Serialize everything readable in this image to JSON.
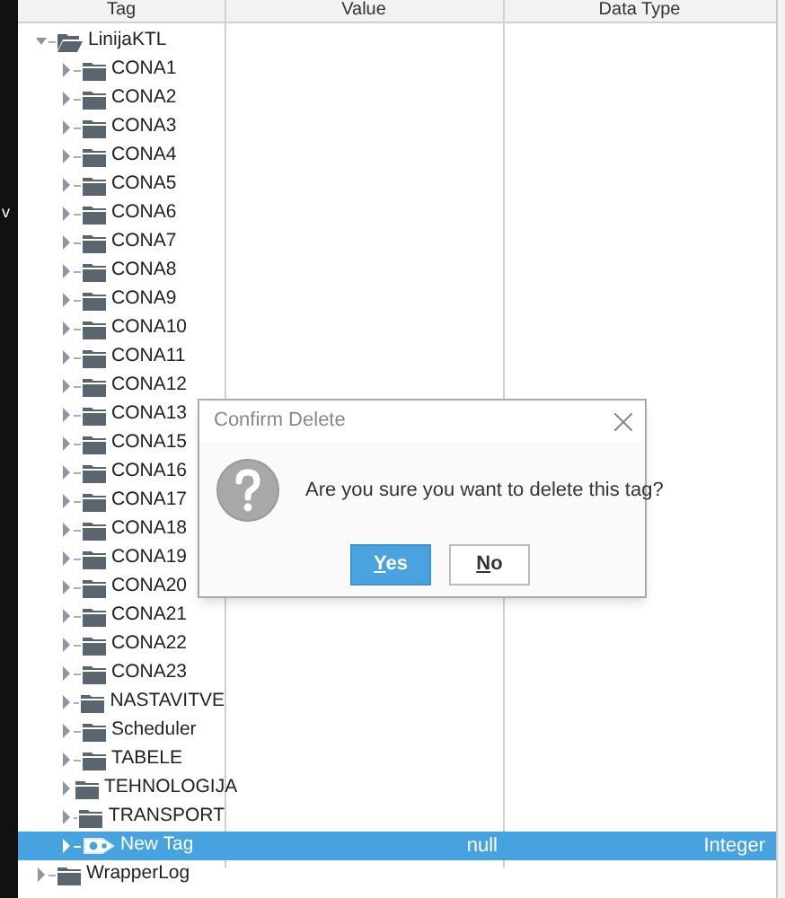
{
  "left_strip": {
    "text": "v"
  },
  "columns": [
    "Tag",
    "Value",
    "Data Type"
  ],
  "tree": [
    {
      "label": "LinijaKTL",
      "kind": "folder",
      "expanded": true,
      "selected": false,
      "children": [
        {
          "label": "CONA1",
          "kind": "folder",
          "expanded": false,
          "selected": false
        },
        {
          "label": "CONA2",
          "kind": "folder",
          "expanded": false,
          "selected": false
        },
        {
          "label": "CONA3",
          "kind": "folder",
          "expanded": false,
          "selected": false
        },
        {
          "label": "CONA4",
          "kind": "folder",
          "expanded": false,
          "selected": false
        },
        {
          "label": "CONA5",
          "kind": "folder",
          "expanded": false,
          "selected": false
        },
        {
          "label": "CONA6",
          "kind": "folder",
          "expanded": false,
          "selected": false
        },
        {
          "label": "CONA7",
          "kind": "folder",
          "expanded": false,
          "selected": false
        },
        {
          "label": "CONA8",
          "kind": "folder",
          "expanded": false,
          "selected": false
        },
        {
          "label": "CONA9",
          "kind": "folder",
          "expanded": false,
          "selected": false
        },
        {
          "label": "CONA10",
          "kind": "folder",
          "expanded": false,
          "selected": false
        },
        {
          "label": "CONA11",
          "kind": "folder",
          "expanded": false,
          "selected": false
        },
        {
          "label": "CONA12",
          "kind": "folder",
          "expanded": false,
          "selected": false
        },
        {
          "label": "CONA13",
          "kind": "folder",
          "expanded": false,
          "selected": false
        },
        {
          "label": "CONA15",
          "kind": "folder",
          "expanded": false,
          "selected": false
        },
        {
          "label": "CONA16",
          "kind": "folder",
          "expanded": false,
          "selected": false
        },
        {
          "label": "CONA17",
          "kind": "folder",
          "expanded": false,
          "selected": false
        },
        {
          "label": "CONA18",
          "kind": "folder",
          "expanded": false,
          "selected": false
        },
        {
          "label": "CONA19",
          "kind": "folder",
          "expanded": false,
          "selected": false
        },
        {
          "label": "CONA20",
          "kind": "folder",
          "expanded": false,
          "selected": false
        },
        {
          "label": "CONA21",
          "kind": "folder",
          "expanded": false,
          "selected": false
        },
        {
          "label": "CONA22",
          "kind": "folder",
          "expanded": false,
          "selected": false
        },
        {
          "label": "CONA23",
          "kind": "folder",
          "expanded": false,
          "selected": false
        },
        {
          "label": "NASTAVITVE",
          "kind": "folder",
          "expanded": false,
          "selected": false
        },
        {
          "label": "Scheduler",
          "kind": "folder",
          "expanded": false,
          "selected": false
        },
        {
          "label": "TABELE",
          "kind": "folder",
          "expanded": false,
          "selected": false
        },
        {
          "label": "TEHNOLOGIJA",
          "kind": "folder",
          "expanded": false,
          "selected": false
        },
        {
          "label": "TRANSPORT",
          "kind": "folder",
          "expanded": false,
          "selected": false
        },
        {
          "label": "New Tag",
          "kind": "tag",
          "expanded": false,
          "selected": true,
          "value": "null",
          "data_type": "Integer"
        }
      ]
    },
    {
      "label": "WrapperLog",
      "kind": "folder",
      "expanded": false,
      "selected": false
    }
  ],
  "dialog": {
    "title": "Confirm Delete",
    "message": "Are you sure you want to delete this tag?",
    "buttons": [
      {
        "label": "Yes",
        "default": true
      },
      {
        "label": "No",
        "default": false
      }
    ]
  }
}
